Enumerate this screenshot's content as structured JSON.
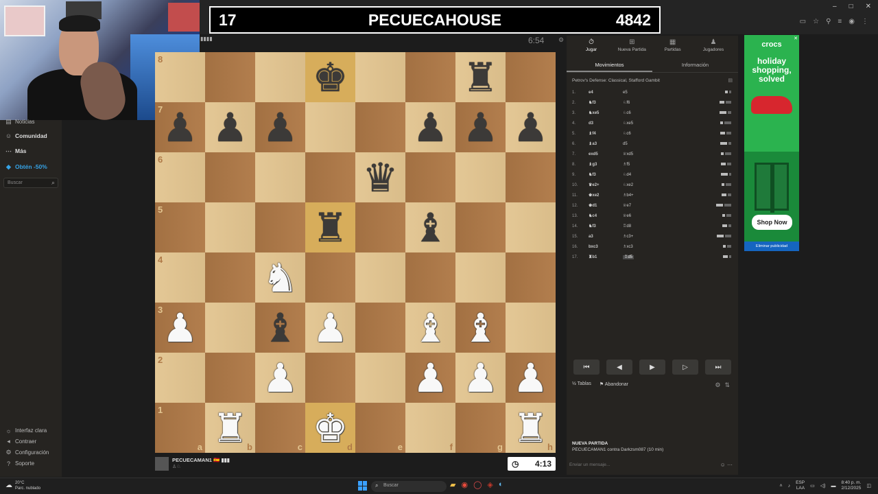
{
  "banner": {
    "left": "17",
    "name": "PECUECAHOUSE",
    "right": "4842"
  },
  "browser": {
    "min": "–",
    "max": "□",
    "close": "✕"
  },
  "sidebar": {
    "items": [
      {
        "label": "Noticias",
        "icon": "newspaper-icon"
      },
      {
        "label": "Comunidad",
        "icon": "community-icon"
      },
      {
        "label": "Más",
        "icon": "more-icon"
      },
      {
        "label": "Obtén -50%",
        "icon": "diamond-icon"
      }
    ],
    "search_placeholder": "Buscar",
    "bottom": [
      {
        "label": "Interfaz clara",
        "icon": "sun-icon"
      },
      {
        "label": "Contraer",
        "icon": "collapse-icon"
      },
      {
        "label": "Configuración",
        "icon": "gear-icon"
      },
      {
        "label": "Soporte",
        "icon": "help-icon"
      }
    ]
  },
  "game": {
    "opponent_clock": "6:54",
    "player_name": "PECUECAMAN1",
    "player_flag": "🇪🇸 ▮▮▮",
    "player_clock": "4:13",
    "board": [
      [
        "",
        "",
        "",
        "bk",
        "",
        "",
        "br",
        ""
      ],
      [
        "bp",
        "bp",
        "bp",
        "",
        "",
        "bp",
        "bp",
        "bp"
      ],
      [
        "",
        "",
        "",
        "",
        "bq",
        "",
        "",
        ""
      ],
      [
        "",
        "",
        "",
        "br",
        "",
        "bb",
        "",
        ""
      ],
      [
        "",
        "",
        "wn",
        "",
        "",
        "",
        "",
        ""
      ],
      [
        "wp",
        "",
        "bb",
        "wp",
        "",
        "wb",
        "wb",
        ""
      ],
      [
        "",
        "",
        "wp",
        "",
        "",
        "wp",
        "wp",
        "wp"
      ],
      [
        "",
        "wr",
        "",
        "wk",
        "",
        "",
        "",
        "wr"
      ]
    ],
    "highlights": [
      [
        0,
        3
      ],
      [
        7,
        3
      ],
      [
        3,
        3
      ]
    ],
    "ranks": [
      "8",
      "7",
      "6",
      "5",
      "4",
      "3",
      "2",
      "1"
    ],
    "files": [
      "a",
      "b",
      "c",
      "d",
      "e",
      "f",
      "g",
      "h"
    ]
  },
  "panel": {
    "tabs": [
      "Jugar",
      "Nueva Partida",
      "Partidas",
      "Jugadores"
    ],
    "subtabs": [
      "Movimientos",
      "Información"
    ],
    "opening": "Petrov's Defense: Classical, Stafford Gambit",
    "moves": [
      {
        "n": "1.",
        "w": "e4",
        "b": "e5"
      },
      {
        "n": "2.",
        "w": "♞f3",
        "b": "♘f6"
      },
      {
        "n": "3.",
        "w": "♞xe5",
        "b": "♘c6"
      },
      {
        "n": "4.",
        "w": "d3",
        "b": "♘xe5"
      },
      {
        "n": "5.",
        "w": "♝f4",
        "b": "♘c6"
      },
      {
        "n": "6.",
        "w": "♝a3",
        "b": "d5"
      },
      {
        "n": "7.",
        "w": "exd5",
        "b": "♕xd5"
      },
      {
        "n": "8.",
        "w": "♝g3",
        "b": "♗f5"
      },
      {
        "n": "9.",
        "w": "♞f3",
        "b": "♘d4"
      },
      {
        "n": "10.",
        "w": "♛e2+",
        "b": "♘xe2"
      },
      {
        "n": "11.",
        "w": "♚xe2",
        "b": "♗b4+"
      },
      {
        "n": "12.",
        "w": "♚d1",
        "b": "♕e7"
      },
      {
        "n": "13.",
        "w": "♞c4",
        "b": "♕e6"
      },
      {
        "n": "14.",
        "w": "♞f3",
        "b": "♖d8"
      },
      {
        "n": "15.",
        "w": "a3",
        "b": "♗c3+"
      },
      {
        "n": "16.",
        "w": "bxc3",
        "b": "♗xc3"
      },
      {
        "n": "17.",
        "w": "♜b1",
        "b": "♖d5"
      }
    ],
    "nav": [
      "⏮",
      "◀",
      "▶",
      "▶",
      "⏭"
    ],
    "draw_label": "Tablas",
    "resign_label": "Abandonar",
    "game_title": "NUEVA PARTIDA",
    "game_desc": "PECUECAMAN1 contra Darkzsm087 (10 min)",
    "message_placeholder": "Enviar un mensaje..."
  },
  "ad": {
    "brand": "crocs",
    "headline": "holiday shopping, solved",
    "cta": "Shop Now",
    "remove": "Eliminar publicidad"
  },
  "taskbar": {
    "temp": "20°C",
    "weather": "Parc. nublado",
    "search": "Buscar",
    "lang": "ESP",
    "lang2": "LAA",
    "time": "8:40 p. m.",
    "date": "2/12/2025"
  }
}
